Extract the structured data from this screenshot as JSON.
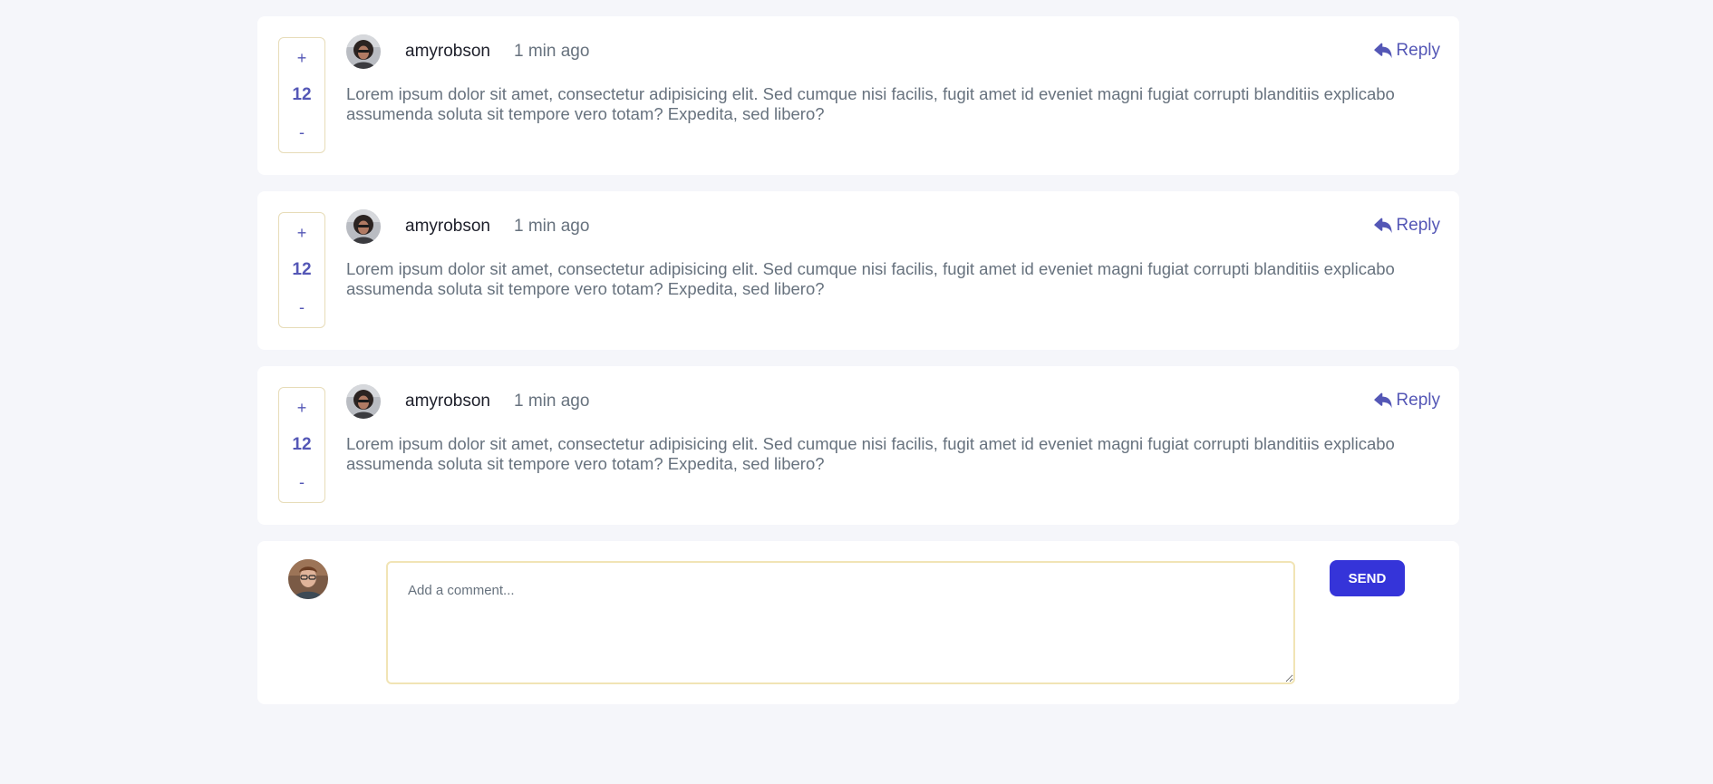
{
  "colors": {
    "accent": "#5457b6",
    "send_button": "#3534d9",
    "text_muted": "#67727e",
    "text_dark": "#1d1f2a",
    "background": "#f5f6fa"
  },
  "comments": [
    {
      "upvote_label": "+",
      "score": "12",
      "downvote_label": "-",
      "author": "amyrobson",
      "time": "1 min ago",
      "reply_label": "Reply",
      "reply_icon": "reply-arrow-icon",
      "content": "Lorem ipsum dolor sit amet, consectetur adipisicing elit. Sed cumque nisi facilis, fugit amet id eveniet magni fugiat corrupti blanditiis explicabo assumenda soluta sit tempore vero totam? Expedita, sed libero?"
    },
    {
      "upvote_label": "+",
      "score": "12",
      "downvote_label": "-",
      "author": "amyrobson",
      "time": "1 min ago",
      "reply_label": "Reply",
      "reply_icon": "reply-arrow-icon",
      "content": "Lorem ipsum dolor sit amet, consectetur adipisicing elit. Sed cumque nisi facilis, fugit amet id eveniet magni fugiat corrupti blanditiis explicabo assumenda soluta sit tempore vero totam? Expedita, sed libero?"
    },
    {
      "upvote_label": "+",
      "score": "12",
      "downvote_label": "-",
      "author": "amyrobson",
      "time": "1 min ago",
      "reply_label": "Reply",
      "reply_icon": "reply-arrow-icon",
      "content": "Lorem ipsum dolor sit amet, consectetur adipisicing elit. Sed cumque nisi facilis, fugit amet id eveniet magni fugiat corrupti blanditiis explicabo assumenda soluta sit tempore vero totam? Expedita, sed libero?"
    }
  ],
  "compose": {
    "placeholder": "Add a comment...",
    "value": "",
    "send_label": "SEND"
  }
}
